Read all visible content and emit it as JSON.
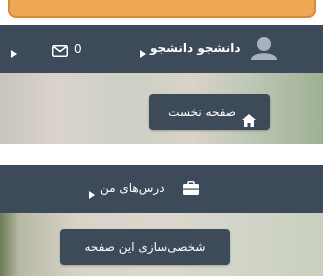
{
  "user_bar": {
    "user_name": "دانشجو دانشجو",
    "message_count": "0"
  },
  "home_button": {
    "label": "صفحه نخست"
  },
  "courses_bar": {
    "label": "درس‌های من"
  },
  "customize_button": {
    "label": "شخصی‌سازی این صفحه"
  },
  "colors": {
    "bar": "#3c4a59",
    "alert": "#f0a754",
    "text": "#ffffff"
  }
}
